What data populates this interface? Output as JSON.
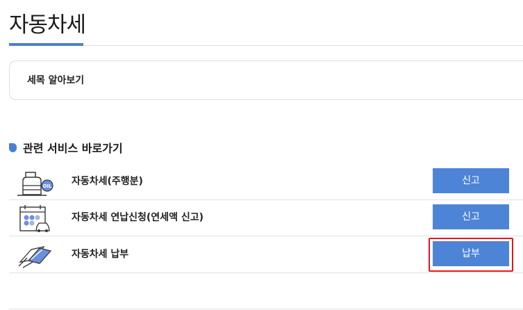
{
  "page": {
    "title": "자동차세"
  },
  "info_box": {
    "label": "세목 알아보기"
  },
  "related_services": {
    "title": "관련 서비스 바로가기",
    "items": [
      {
        "icon": "fuel-tank-oil-icon",
        "label": "자동차세(주행분)",
        "button_label": "신고"
      },
      {
        "icon": "calendar-car-icon",
        "label": "자동차세 연납신청(연세액 신고)",
        "button_label": "신고"
      },
      {
        "icon": "card-payment-icon",
        "label": "자동차세 납부",
        "button_label": "납부",
        "highlighted": true
      }
    ]
  },
  "colors": {
    "accent": "#4a7fd4",
    "button": "#4e84d6",
    "highlight": "#e8151b"
  }
}
